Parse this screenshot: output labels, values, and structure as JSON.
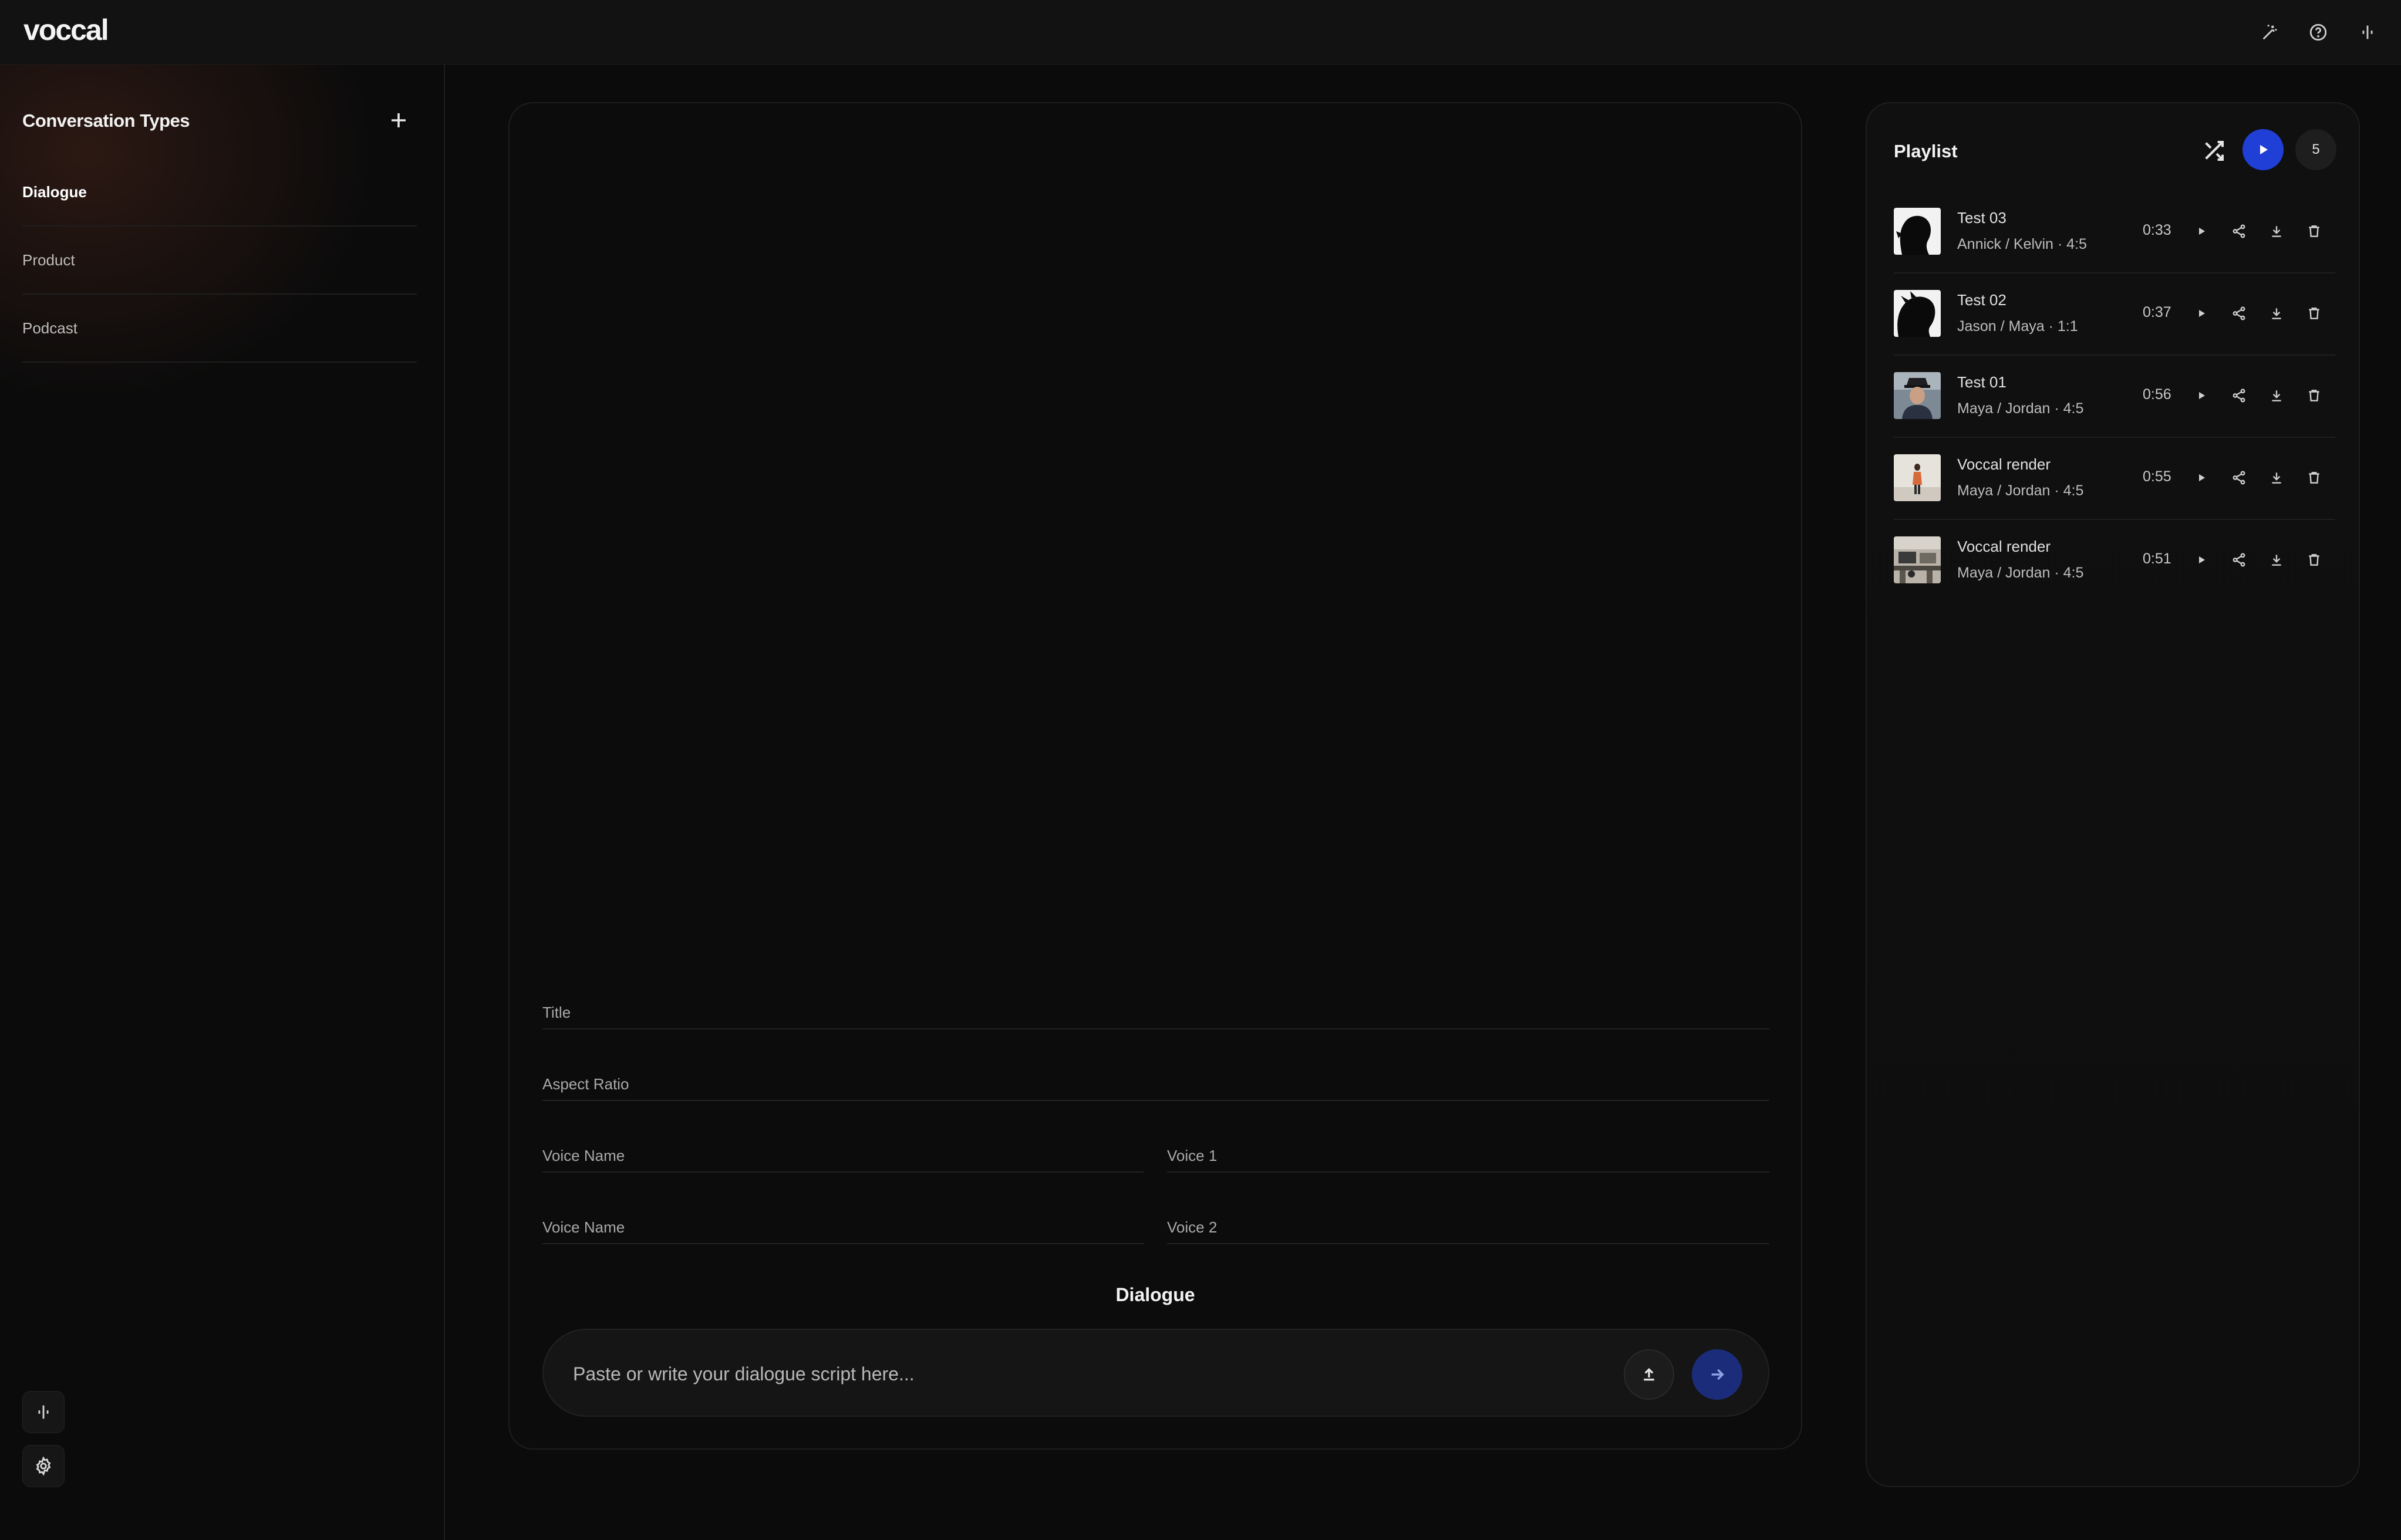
{
  "app": {
    "logo": "voccal"
  },
  "topbar": {
    "icons": [
      "magic-wand-icon",
      "help-icon",
      "voice-icon"
    ]
  },
  "sidebar": {
    "title": "Conversation Types",
    "add_icon": "plus-icon",
    "items": [
      {
        "label": "Dialogue",
        "active": true
      },
      {
        "label": "Product",
        "active": false
      },
      {
        "label": "Podcast",
        "active": false
      }
    ],
    "bottom_icons": [
      "voice-icon",
      "gear-icon"
    ]
  },
  "form": {
    "title_placeholder": "Title",
    "aspect_ratio_placeholder": "Aspect Ratio",
    "voice_name_1_placeholder": "Voice Name",
    "voice_1_placeholder": "Voice 1",
    "voice_name_2_placeholder": "Voice Name",
    "voice_2_placeholder": "Voice 2",
    "section_heading": "Dialogue",
    "script_placeholder": "Paste or write your dialogue script here..."
  },
  "playlist": {
    "title": "Playlist",
    "count": "5",
    "accent_color": "#1f3fd6",
    "items": [
      {
        "name": "Test 03",
        "meta": "Annick / Kelvin · 4:5",
        "duration": "0:33",
        "thumb": "silhouette-profile"
      },
      {
        "name": "Test 02",
        "meta": "Jason / Maya · 1:1",
        "duration": "0:37",
        "thumb": "silhouette-hair"
      },
      {
        "name": "Test 01",
        "meta": "Maya / Jordan · 4:5",
        "duration": "0:56",
        "thumb": "man-with-hat"
      },
      {
        "name": "Voccal render",
        "meta": "Maya / Jordan · 4:5",
        "duration": "0:55",
        "thumb": "person-standing"
      },
      {
        "name": "Voccal render",
        "meta": "Maya / Jordan · 4:5",
        "duration": "0:51",
        "thumb": "room-scene"
      }
    ]
  }
}
